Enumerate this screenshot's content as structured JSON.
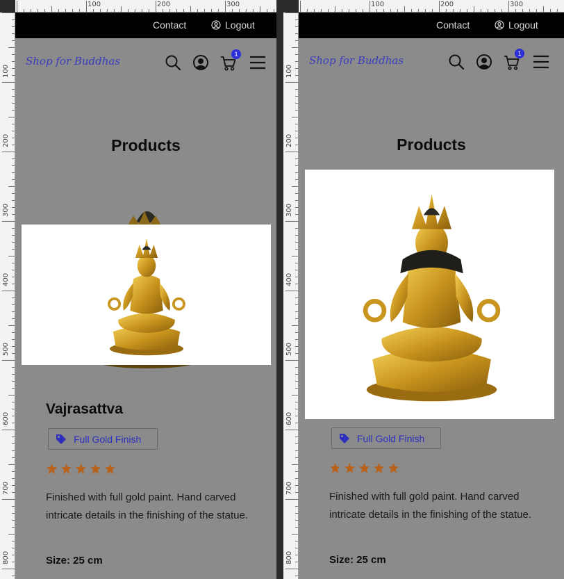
{
  "ruler": {
    "h_labels": [
      "100",
      "200",
      "300"
    ],
    "v_labels": [
      "100",
      "200",
      "300",
      "400",
      "500",
      "600",
      "700",
      "800"
    ]
  },
  "topbar": {
    "contact": "Contact",
    "logout": "Logout"
  },
  "brand": {
    "logo": "Shop for Buddhas"
  },
  "cart": {
    "count": "1"
  },
  "page": {
    "title": "Products"
  },
  "product": {
    "name": "Vajrasattva",
    "finish": "Full Gold Finish",
    "rating": 5,
    "rating_max": 5,
    "description": "Finished with full gold paint. Hand carved intricate details in the finishing of the statue.",
    "size_label": "Size: 25 cm"
  },
  "icons": [
    "search-icon",
    "user-circle-icon",
    "cart-icon",
    "menu-icon",
    "tag-icon",
    "star-icon",
    "user-icon"
  ],
  "colors": {
    "topbar": "#000000",
    "page_bg": "#8b8b8b",
    "brand": "#3a3dbf",
    "badge": "#2d2fd6",
    "star": "#b8621c",
    "tag_text": "#2c2fc0"
  }
}
